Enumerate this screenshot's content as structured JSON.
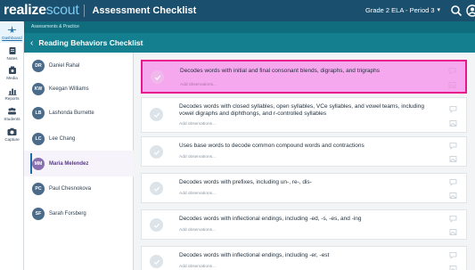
{
  "header": {
    "logo_part1": "realize",
    "logo_part2": "scout",
    "title": "Assessment Checklist",
    "class_selector": "Grade 2 ELA - Period 3"
  },
  "rail": [
    {
      "label": "Dashboard",
      "icon": "compass-icon",
      "active": true
    },
    {
      "label": "Notes",
      "icon": "notes-icon"
    },
    {
      "label": "Media",
      "icon": "media-icon"
    },
    {
      "label": "Reports",
      "icon": "reports-icon"
    },
    {
      "label": "Students",
      "icon": "students-icon"
    },
    {
      "label": "Capture",
      "icon": "camera-icon"
    }
  ],
  "breadcrumb": "Assessments & Practice",
  "subheader": {
    "title": "Reading Behaviors Checklist"
  },
  "students": [
    {
      "initials": "DR",
      "name": "Daniel Rahal"
    },
    {
      "initials": "KW",
      "name": "Keegan Williams"
    },
    {
      "initials": "LB",
      "name": "Lashonda Burnette"
    },
    {
      "initials": "LC",
      "name": "Lee Chang"
    },
    {
      "initials": "MM",
      "name": "Maria Melendez",
      "selected": true
    },
    {
      "initials": "PC",
      "name": "Paul Chesnokova"
    },
    {
      "initials": "SF",
      "name": "Sarah Forsberg"
    }
  ],
  "checklist": {
    "observations_placeholder": "Add observations...",
    "items": [
      {
        "text": "Decodes words with initial and final consonant blends, digraphs, and trigraphs",
        "highlight": true
      },
      {
        "text": "Decodes words with closed syllables, open syllables, VCe syllables, and vowel teams, including vowel digraphs and diphthongs, and r-controlled syllables"
      },
      {
        "text": "Uses base words to decode common compound words and contractions"
      },
      {
        "text": "Decodes words with prefixes, including un-, re-, dis-"
      },
      {
        "text": "Decodes words with inflectional endings, including -ed, -s, -es, and -ing"
      },
      {
        "text": "Decodes words with inflectional endings, including -er, -est"
      }
    ]
  },
  "colors": {
    "topbar": "#1b4f6e",
    "teal": "#137f8f",
    "highlight": "#e8178c",
    "selected": "#8a6fb0"
  }
}
